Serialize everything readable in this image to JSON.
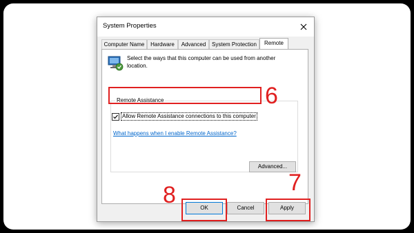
{
  "dialog": {
    "title": "System Properties",
    "close_glyph": "✕"
  },
  "tabs": [
    {
      "label": "Computer Name",
      "active": false
    },
    {
      "label": "Hardware",
      "active": false
    },
    {
      "label": "Advanced",
      "active": false
    },
    {
      "label": "System Protection",
      "active": false
    },
    {
      "label": "Remote",
      "active": true
    }
  ],
  "remote": {
    "description": "Select the ways that this computer can be used from another location.",
    "group_label": "Remote Assistance",
    "allow_label": "Allow Remote Assistance connections to this computer",
    "allow_checked": true,
    "help_link": "What happens when I enable Remote Assistance?",
    "advanced_button": "Advanced..."
  },
  "buttons": {
    "ok": "OK",
    "cancel": "Cancel",
    "apply": "Apply"
  },
  "annotations": {
    "step_checkbox": "6",
    "step_apply": "7",
    "step_ok": "8",
    "color": "#e02020"
  },
  "icons": {
    "computer": "computer-network-icon",
    "close": "close-icon",
    "check": "checkmark-icon"
  }
}
